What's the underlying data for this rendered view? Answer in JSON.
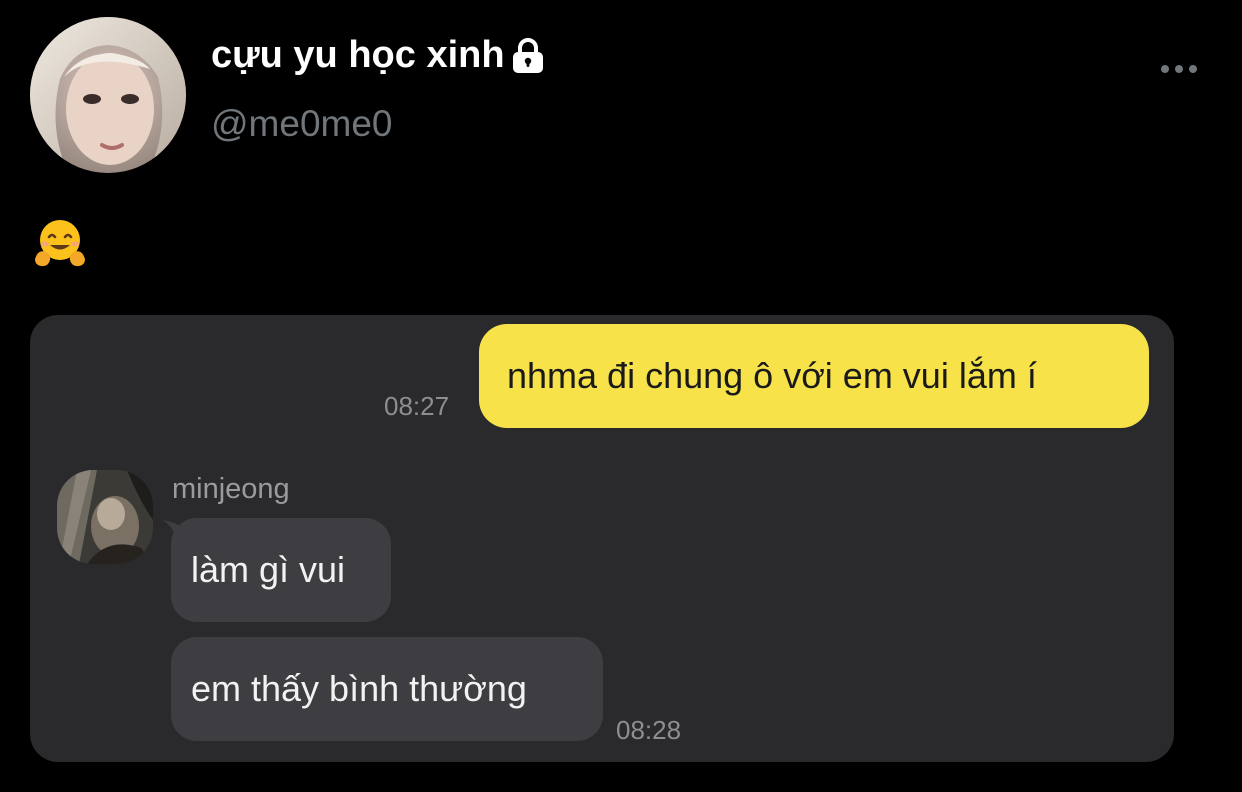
{
  "profile": {
    "display_name": "cựu yu học xinh",
    "handle": "@me0me0",
    "avatar_icon": "profile-photo",
    "locked_icon": "lock-icon"
  },
  "header": {
    "more_icon": "more-horizontal-icon"
  },
  "post": {
    "emoji": "🤗"
  },
  "chat": {
    "outgoing": {
      "text": "nhma đi chung ô với em vui lắm í",
      "time": "08:27"
    },
    "friend_name": "minjeong",
    "incoming": [
      {
        "text": "làm gì vui"
      },
      {
        "text": "em thấy bình thường"
      }
    ],
    "incoming_time": "08:28"
  },
  "colors": {
    "background": "#000000",
    "card": "#2a2a2d",
    "outgoing_bubble": "#f7e24a",
    "incoming_bubble": "#3e3e42",
    "muted_text": "#71767b"
  }
}
